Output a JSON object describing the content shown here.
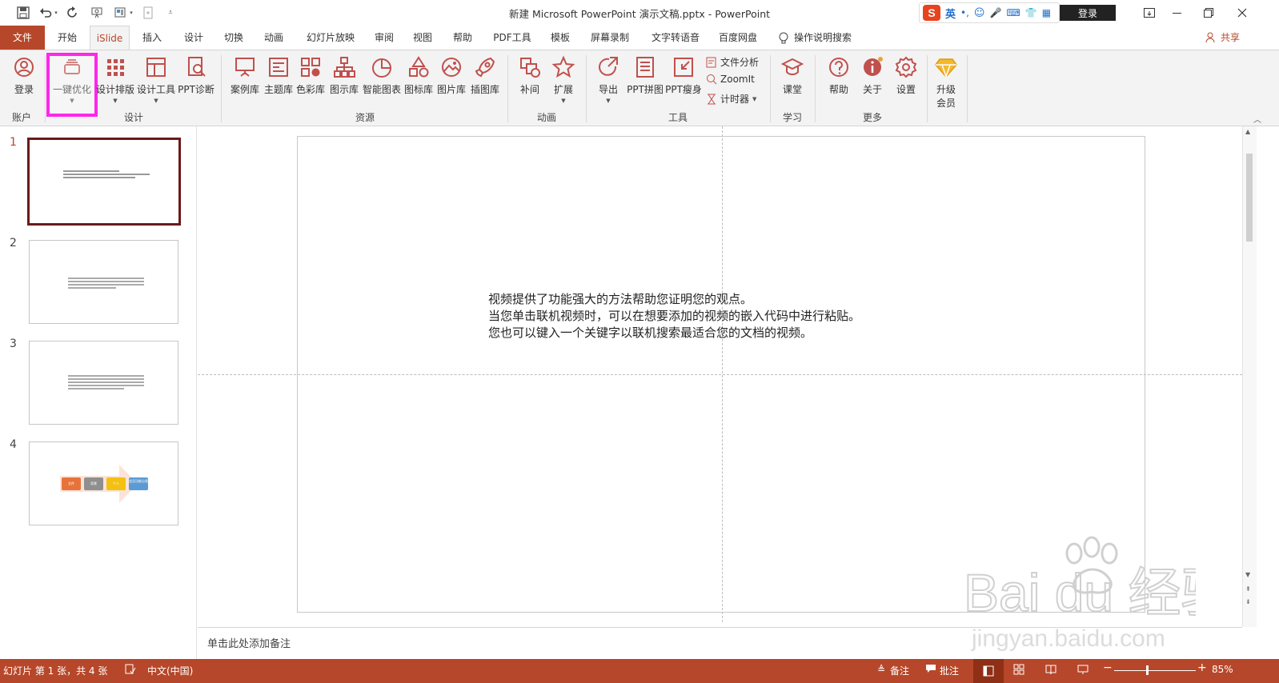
{
  "window": {
    "title": "新建 Microsoft PowerPoint 演示文稿.pptx  -  PowerPoint",
    "login_button": "登录",
    "ime_lang": "英"
  },
  "tabs": [
    {
      "label": "文件"
    },
    {
      "label": "开始"
    },
    {
      "label": "iSlide"
    },
    {
      "label": "插入"
    },
    {
      "label": "设计"
    },
    {
      "label": "切换"
    },
    {
      "label": "动画"
    },
    {
      "label": "幻灯片放映"
    },
    {
      "label": "审阅"
    },
    {
      "label": "视图"
    },
    {
      "label": "帮助"
    },
    {
      "label": "PDF工具"
    },
    {
      "label": "模板"
    },
    {
      "label": "屏幕录制"
    },
    {
      "label": "文字转语音"
    },
    {
      "label": "百度网盘"
    }
  ],
  "tell_me": "操作说明搜索",
  "share": "共享",
  "ribbon": {
    "account": {
      "label": "账户",
      "login": "登录"
    },
    "design": {
      "label": "设计",
      "optimize": "一键优化",
      "layout": "设计排版",
      "tools": "设计工具",
      "diagnose": "PPT诊断"
    },
    "resources": {
      "label": "资源",
      "cases": "案例库",
      "themes": "主题库",
      "colors": "色彩库",
      "diagrams": "图示库",
      "charts": "智能图表",
      "icons": "图标库",
      "images": "图片库",
      "illustrations": "插图库"
    },
    "animation": {
      "label": "动画",
      "tween": "补间",
      "extend": "扩展"
    },
    "tools": {
      "label": "工具",
      "export": "导出",
      "ppt_mosaic": "PPT拼图",
      "ppt_slim": "PPT瘦身",
      "file_analysis": "文件分析",
      "zoomit": "ZoomIt",
      "timer": "计时器"
    },
    "learn": {
      "label": "学习",
      "classroom": "课堂"
    },
    "more": {
      "label": "更多",
      "help": "帮助",
      "about": "关于",
      "settings": "设置",
      "upgrade_line1": "升级",
      "upgrade_line2": "会员"
    }
  },
  "slides": [
    {
      "number": "1"
    },
    {
      "number": "2"
    },
    {
      "number": "3"
    },
    {
      "number": "4"
    }
  ],
  "thumb4": {
    "b1": "文件",
    "b2": "背景",
    "b3": "个人",
    "b4": "会员功能分类"
  },
  "slide_content": {
    "line1": "视频提供了功能强大的方法帮助您证明您的观点。",
    "line2": "当您单击联机视频时，可以在想要添加的视频的嵌入代码中进行粘贴。",
    "line3": "您也可以键入一个关键字以联机搜索最适合您的文档的视频。"
  },
  "notes_placeholder": "单击此处添加备注",
  "status": {
    "slide_info": "幻灯片 第 1 张，共 4 张",
    "language": "中文(中国)",
    "notes": "备注",
    "comments": "批注",
    "zoom": "85%"
  },
  "watermark": {
    "brand": "Bai du 经验",
    "url": "jingyan.baidu.com"
  },
  "colors": {
    "accent": "#b7472a",
    "highlight": "#ff27ea",
    "icon": "#c0504d"
  }
}
